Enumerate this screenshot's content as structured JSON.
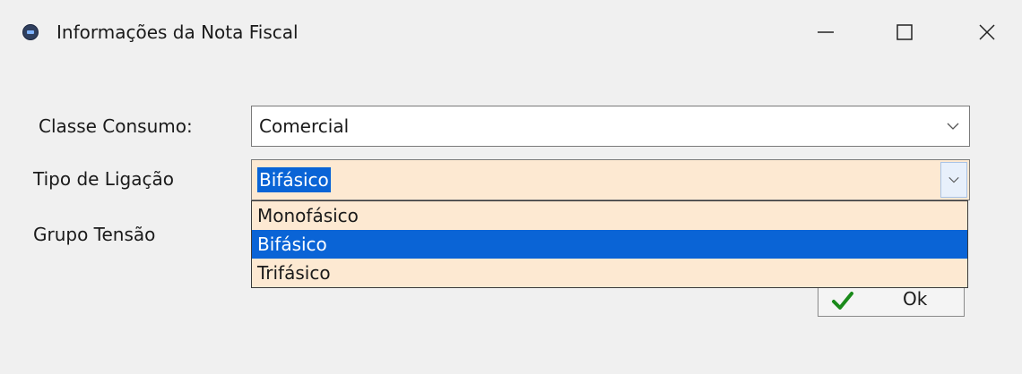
{
  "window": {
    "title": "Informações da Nota Fiscal",
    "controls": {
      "minimize": "—",
      "maximize": "☐",
      "close": "✕"
    }
  },
  "form": {
    "classe_consumo": {
      "label": "Classe Consumo:",
      "value": "Comercial"
    },
    "tipo_ligacao": {
      "label": "Tipo de Ligação",
      "value": "Bifásico",
      "options": [
        "Monofásico",
        "Bifásico",
        "Trifásico"
      ],
      "selected_index": 1
    },
    "grupo_tensao": {
      "label": "Grupo Tensão"
    }
  },
  "actions": {
    "ok_label": "Ok"
  },
  "colors": {
    "highlight": "#0a64d6",
    "combo_bg": "#fde9d2",
    "window_bg": "#f0f0f0",
    "check": "#1a8a1a"
  },
  "icons": {
    "app": "app-icon",
    "chevron": "chevron-down-icon",
    "ok": "checkmark-icon"
  }
}
